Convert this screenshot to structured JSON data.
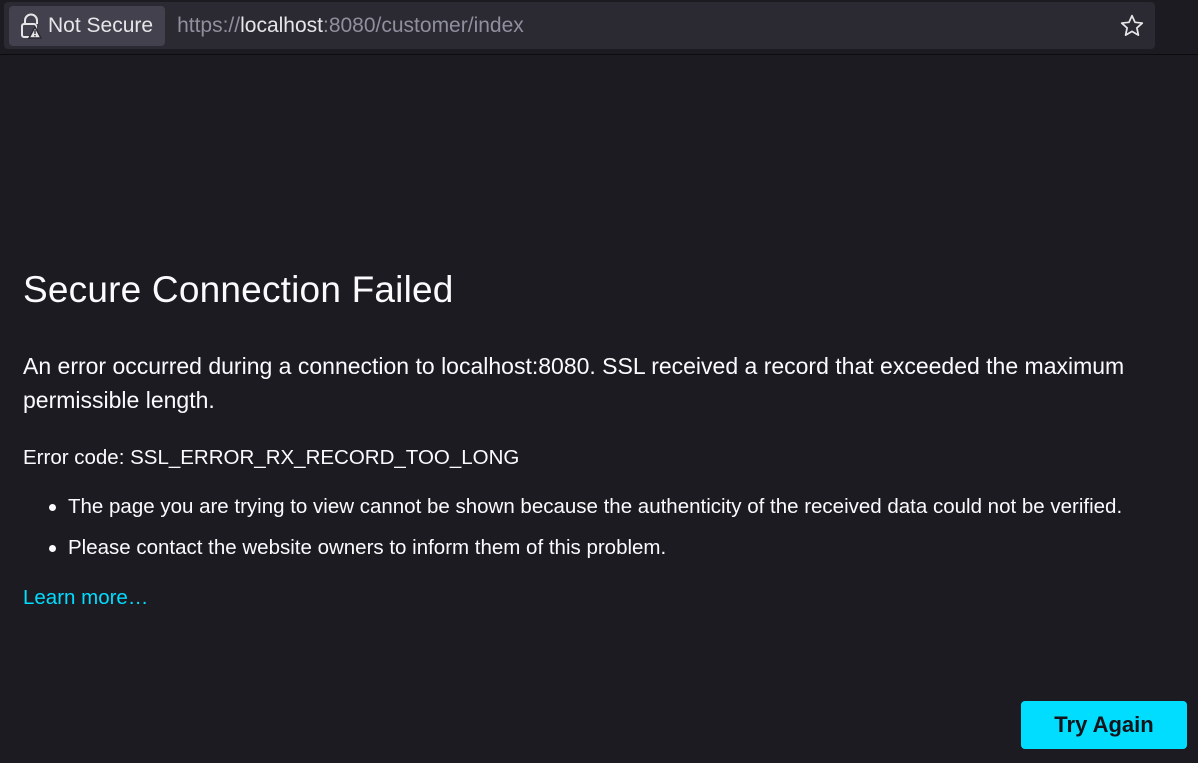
{
  "urlbar": {
    "identity_label": "Not Secure",
    "url_scheme": "https://",
    "url_host": "localhost",
    "url_rest": ":8080/customer/index",
    "lock_icon": "insecure-lock-icon",
    "bookmark_icon": "star-icon"
  },
  "error": {
    "title": "Secure Connection Failed",
    "description": "An error occurred during a connection to localhost:8080. SSL received a record that exceeded the maximum permissible length.",
    "code_label": "Error code: ",
    "code_value": "SSL_ERROR_RX_RECORD_TOO_LONG",
    "bullets": [
      "The page you are trying to view cannot be shown because the authenticity of the received data could not be verified.",
      "Please contact the website owners to inform them of this problem."
    ],
    "learn_more": "Learn more…",
    "try_again": "Try Again"
  },
  "colors": {
    "background": "#1c1b22",
    "accent": "#00ddff",
    "text": "#fbfbfe"
  }
}
